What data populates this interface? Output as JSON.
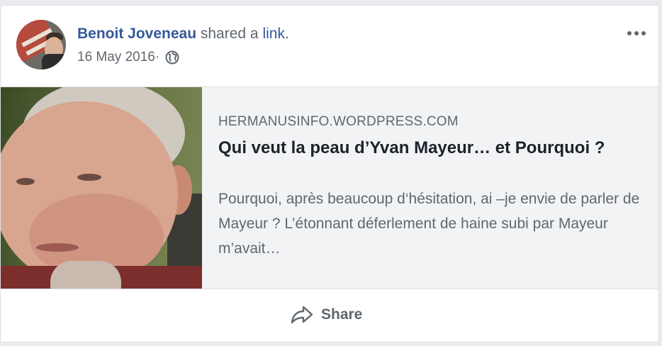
{
  "post": {
    "author": "Benoit Joveneau",
    "verb": " shared a ",
    "link_word": "link",
    "period": ".",
    "date": "16 May 2016",
    "separator": " ·",
    "privacy_icon": "globe-icon",
    "more_icon": "more-options-icon"
  },
  "link_preview": {
    "site": "HERMANUSINFO.WORDPRESS.COM",
    "title": "Qui veut la peau d’Yvan Mayeur… et Pourquoi ?",
    "description": "Pourquoi, après beaucoup d‘hésitation, ai –je envie de parler de Mayeur ? L’étonnant déferlement de haine subi par Mayeur m’avait…"
  },
  "actions": {
    "share_label": "Share",
    "share_icon": "share-arrow-icon"
  },
  "colors": {
    "link_blue": "#365899",
    "meta_gray": "#616770",
    "preview_bg": "#f2f3f5"
  }
}
